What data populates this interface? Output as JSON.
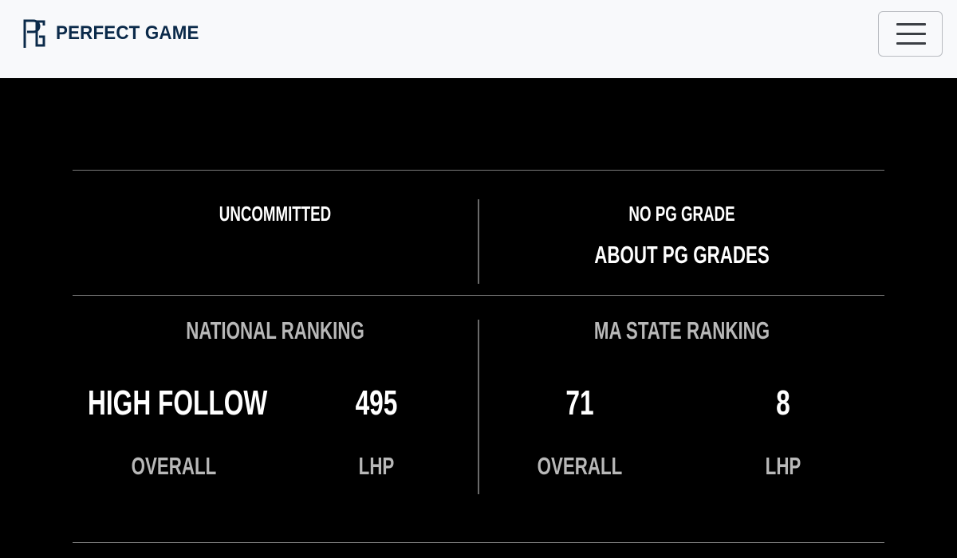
{
  "header": {
    "brand_name": "PERFECT GAME",
    "logo_icon": "pg-logo-icon",
    "menu_icon": "hamburger-menu-icon"
  },
  "commitment": {
    "status": "UNCOMMITTED"
  },
  "grade": {
    "status": "NO PG GRADE",
    "about_link": "ABOUT PG GRADES"
  },
  "national_ranking": {
    "title": "NATIONAL RANKING",
    "overall_value": "HIGH FOLLOW",
    "overall_label": "OVERALL",
    "position_value": "495",
    "position_label": "LHP"
  },
  "state_ranking": {
    "title": "MA STATE RANKING",
    "overall_value": "71",
    "overall_label": "OVERALL",
    "position_value": "8",
    "position_label": "LHP"
  },
  "colors": {
    "header_bg": "#f8f9fb",
    "brand_navy": "#0b2a4a",
    "page_bg": "#000000",
    "divider": "#7a7a7a"
  }
}
